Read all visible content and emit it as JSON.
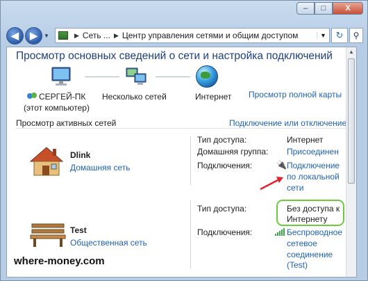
{
  "window": {
    "caption_buttons": [
      "–",
      "□",
      "X"
    ]
  },
  "navbar": {
    "back_icon": "back-arrow-icon",
    "forward_icon": "forward-arrow-icon",
    "breadcrumb": [
      "Сеть ...",
      "Центр управления сетями и общим доступом"
    ]
  },
  "page": {
    "title": "Просмотр основных сведений о сети и настройка подключений",
    "map": {
      "computer_name": "СЕРГЕЙ-ПК",
      "computer_sub": "(этот компьютер)",
      "networks_label": "Несколько сетей",
      "internet_label": "Интернет",
      "full_map_link": "Просмотр полной карты"
    },
    "active_header": "Просмотр активных сетей",
    "connect_link": "Подключение или отключение"
  },
  "networks": [
    {
      "name": "Dlink",
      "type": "Домашняя сеть",
      "access_label": "Тип доступа:",
      "access_value": "Интернет",
      "group_label": "Домашняя группа:",
      "group_value": "Присоединен",
      "conn_label": "Подключения:",
      "conn_value": [
        "Подключение",
        "по локальной",
        "сети"
      ]
    },
    {
      "name": "Test",
      "type": "Общественная сеть",
      "access_label": "Тип доступа:",
      "access_value": [
        "Без доступа к",
        "Интернету"
      ],
      "conn_label": "Подключения:",
      "conn_value": [
        "Беспроводное",
        "сетевое",
        "соединение",
        "(Test)"
      ]
    }
  ],
  "watermark": "where-money.com",
  "colors": {
    "link": "#1f61b2",
    "title": "#1d3f82",
    "highlight_box": "#6ccb3c",
    "arrow": "#e0202a"
  }
}
